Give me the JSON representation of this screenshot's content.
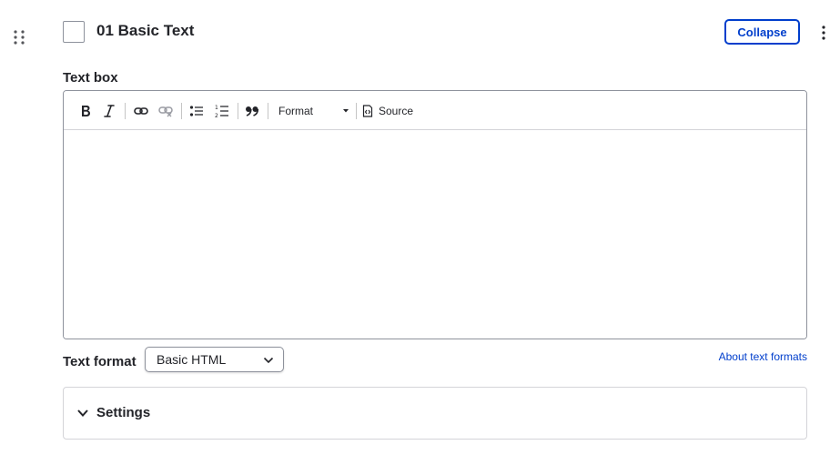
{
  "paragraph": {
    "title": "01 Basic Text",
    "collapse_label": "Collapse"
  },
  "text_box": {
    "label": "Text box",
    "toolbar": {
      "icons": [
        "bold-icon",
        "italic-icon",
        "link-icon",
        "unlink-icon",
        "bulleted-list-icon",
        "numbered-list-icon",
        "blockquote-icon",
        "source-icon"
      ],
      "format_label": "Format",
      "source_label": "Source"
    },
    "content": ""
  },
  "text_format": {
    "label": "Text format",
    "selected": "Basic HTML",
    "help_link": "About text formats"
  },
  "settings": {
    "label": "Settings"
  },
  "colors": {
    "accent": "#003ecc",
    "text": "#232429",
    "border": "#8e929c"
  }
}
